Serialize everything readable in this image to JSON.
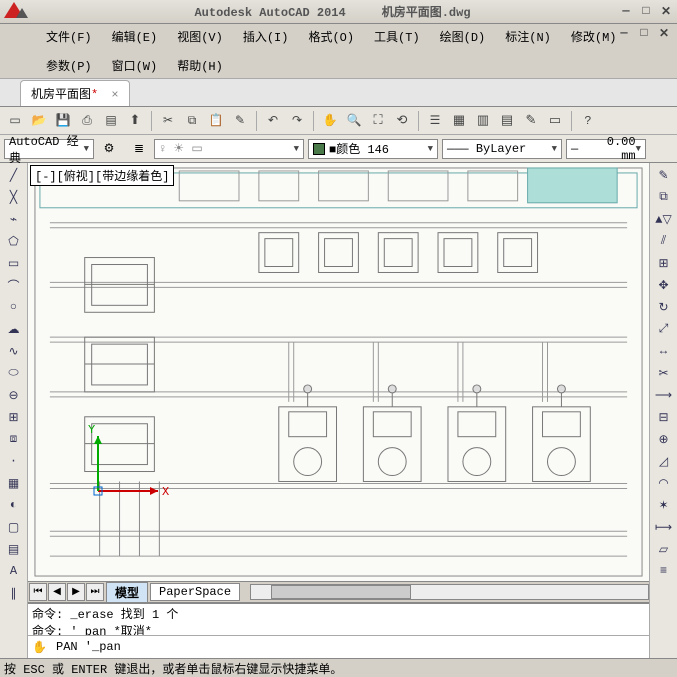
{
  "titlebar": {
    "app_name": "Autodesk AutoCAD 2014",
    "doc_name": "机房平面图.dwg"
  },
  "menu": {
    "file": "文件(F)",
    "edit": "编辑(E)",
    "view": "视图(V)",
    "insert": "插入(I)",
    "format": "格式(O)",
    "tools": "工具(T)",
    "draw": "绘图(D)",
    "dimension": "标注(N)",
    "modify": "修改(M)",
    "parameter": "参数(P)",
    "window": "窗口(W)",
    "help": "帮助(H)"
  },
  "tab": {
    "name": "机房平面图",
    "dirty_mark": "*",
    "close": "×"
  },
  "workspace": {
    "label": "AutoCAD 经典"
  },
  "properties": {
    "color_prefix": "■颜色",
    "color_value": "146",
    "linetype": "ByLayer",
    "lineweight": "0.00 mm"
  },
  "viewport": {
    "view_label": "[-][俯视][带边缘着色]"
  },
  "layout": {
    "model": "模型",
    "paperspace": "PaperSpace"
  },
  "command_history": {
    "line1": "命令: _erase 找到 1 个",
    "line2": "命令: '_pan *取消*"
  },
  "command_input": {
    "value": "PAN '_pan"
  },
  "statusbar": {
    "text": "按 ESC 或 ENTER 键退出，或者单击鼠标右键显示快捷菜单。"
  },
  "icons": {
    "new": "▭",
    "open": "📂",
    "save": "💾",
    "print": "⎙",
    "plot": "▤",
    "cut": "✂",
    "copy": "⧉",
    "paste": "📋",
    "match": "✎",
    "undo": "↶",
    "redo": "↷",
    "pan": "✋",
    "zoom": "🔍",
    "layer": "≣",
    "props": "☰",
    "help": "?"
  }
}
